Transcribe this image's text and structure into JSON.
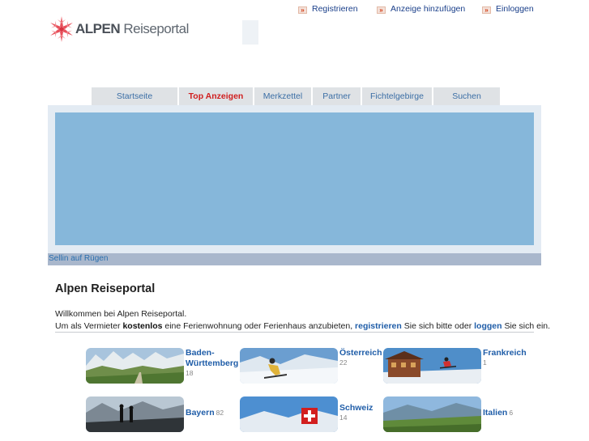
{
  "header": {
    "links": [
      {
        "label": "Registrieren"
      },
      {
        "label": "Anzeige hinzufügen"
      },
      {
        "label": "Einloggen"
      }
    ],
    "logo": {
      "word1": "ALPEN",
      "word2": "Reiseportal"
    }
  },
  "nav": {
    "tabs": [
      {
        "label": "Startseite",
        "active": false
      },
      {
        "label": "Top Anzeigen",
        "active": true
      },
      {
        "label": "Merkzettel",
        "active": false
      },
      {
        "label": "Partner",
        "active": false
      },
      {
        "label": "Fichtelgebirge",
        "active": false
      },
      {
        "label": "Suchen",
        "active": false
      }
    ]
  },
  "banner": {
    "caption": "Sellin auf Rügen"
  },
  "main": {
    "title": "Alpen Reiseportal",
    "welcome": "Willkommen bei Alpen Reiseportal.",
    "intro_pre": "Um als Vermieter ",
    "intro_bold": "kostenlos",
    "intro_mid": " eine Ferienwohnung oder Ferienhaus anzubieten, ",
    "intro_link1": "registrieren",
    "intro_mid2": " Sie sich bitte oder ",
    "intro_link2": "loggen",
    "intro_post": " Sie sich ein."
  },
  "regions": [
    {
      "line1": "Baden-",
      "line2": "Württemberg",
      "count": "18"
    },
    {
      "line1": "Österreich",
      "count": "22"
    },
    {
      "line1": "Frankreich",
      "count": "1"
    },
    {
      "line1": "Bayern",
      "count": "82"
    },
    {
      "line1": "Schweiz",
      "count": "14"
    },
    {
      "line1": "Italien",
      "count": "6"
    }
  ]
}
